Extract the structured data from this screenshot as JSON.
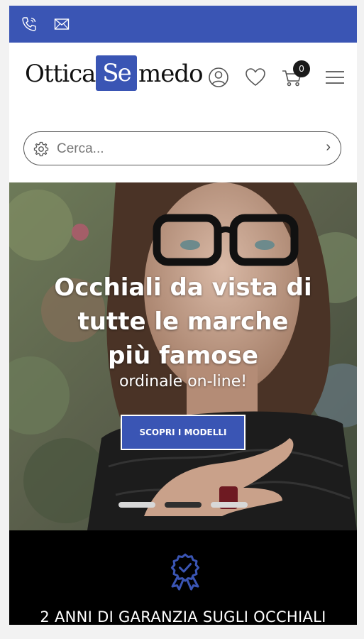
{
  "topbar": {
    "color": "#3a55b4",
    "icons": [
      "phone-icon",
      "mail-icon"
    ]
  },
  "header": {
    "logo": {
      "part1": "Ottica",
      "badge": "Se",
      "part2": "medo"
    },
    "icons": [
      "user-icon",
      "heart-icon",
      "cart-icon",
      "menu-icon"
    ],
    "cart_count": "0"
  },
  "search": {
    "placeholder": "Cerca...",
    "icon": "gear-icon"
  },
  "hero": {
    "title_lines": [
      "Occhiali da vista di",
      "tutte le marche",
      "più famose"
    ],
    "subtitle": "ordinale on-line!",
    "cta_label": "SCOPRI I MODELLI",
    "slides_total": 3,
    "active_slide": 2
  },
  "guarantee": {
    "icon": "award-ribbon-icon",
    "text": "2 ANNI DI GARANZIA SUGLI OCCHIALI"
  },
  "colors": {
    "brand_blue": "#3a55b4",
    "dark": "#000000"
  }
}
